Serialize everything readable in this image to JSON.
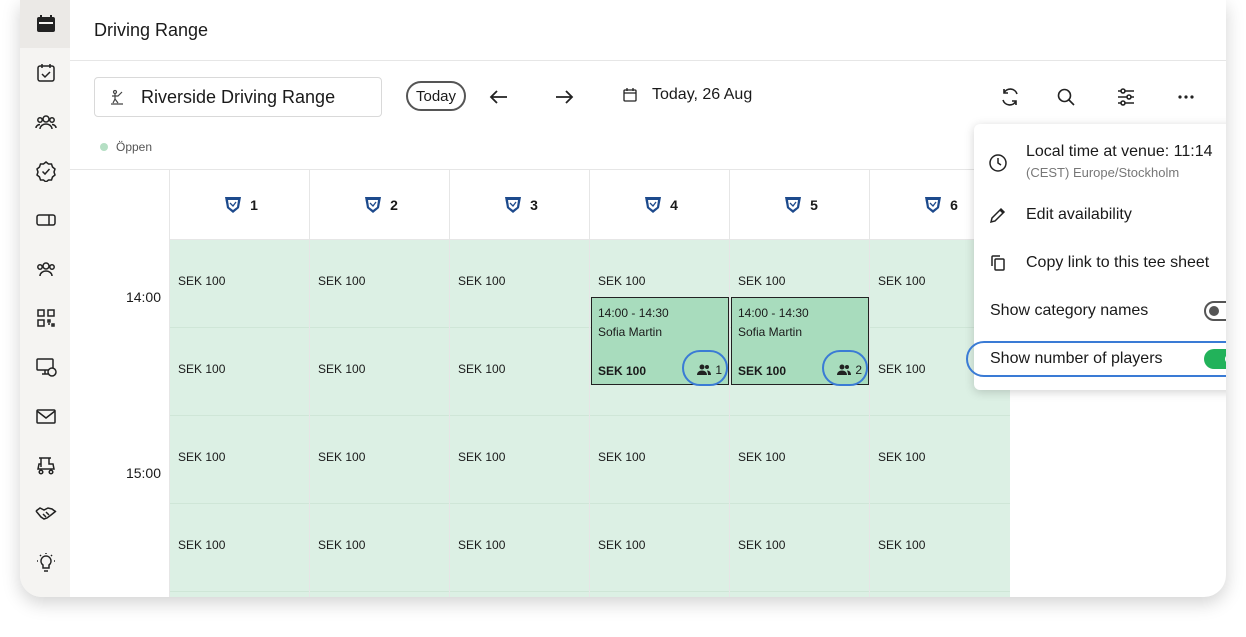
{
  "page": {
    "title": "Driving Range"
  },
  "toolbar": {
    "venue_name": "Riverside Driving Range",
    "today_label": "Today",
    "date_label": "Today, 26 Aug",
    "icons": [
      "refresh-icon",
      "search-icon",
      "filter-sliders-icon",
      "more-dots-icon"
    ]
  },
  "status": {
    "label": "Öppen",
    "color": "#b5dfc4"
  },
  "times": [
    "14:00",
    "15:00"
  ],
  "columns": [
    {
      "num": "1",
      "slots": [
        "SEK 100",
        "SEK 100",
        "SEK 100",
        "SEK 100"
      ]
    },
    {
      "num": "2",
      "slots": [
        "SEK 100",
        "SEK 100",
        "SEK 100",
        "SEK 100"
      ]
    },
    {
      "num": "3",
      "slots": [
        "SEK 100",
        "SEK 100",
        "SEK 100",
        "SEK 100"
      ]
    },
    {
      "num": "4",
      "slots": [
        "SEK 100",
        "",
        "SEK 100",
        "SEK 100"
      ],
      "booking": {
        "time": "14:00 - 14:30",
        "name": "Sofia Martin",
        "price": "SEK 100",
        "players": "1"
      }
    },
    {
      "num": "5",
      "slots": [
        "SEK 100",
        "",
        "SEK 100",
        "SEK 100"
      ],
      "booking": {
        "time": "14:00 - 14:30",
        "name": "Sofia Martin",
        "price": "SEK 100",
        "players": "2"
      }
    },
    {
      "num": "6",
      "slots": [
        "SEK 100",
        "SEK 100",
        "SEK 100",
        "SEK 100"
      ]
    }
  ],
  "menu": {
    "local_time": "Local time at venue: 11:14",
    "timezone": "(CEST) Europe/Stockholm",
    "edit_availability": "Edit availability",
    "copy_link": "Copy link to this tee sheet",
    "show_category_names": "Show category names",
    "show_category_names_on": false,
    "show_number_of_players": "Show number of players",
    "show_number_of_players_on": true
  },
  "colors": {
    "slot_bg": "#dcf0e4",
    "booking_bg": "#a8dcbd",
    "toggle_on": "#22b25a",
    "highlight": "#3a7bd5"
  }
}
